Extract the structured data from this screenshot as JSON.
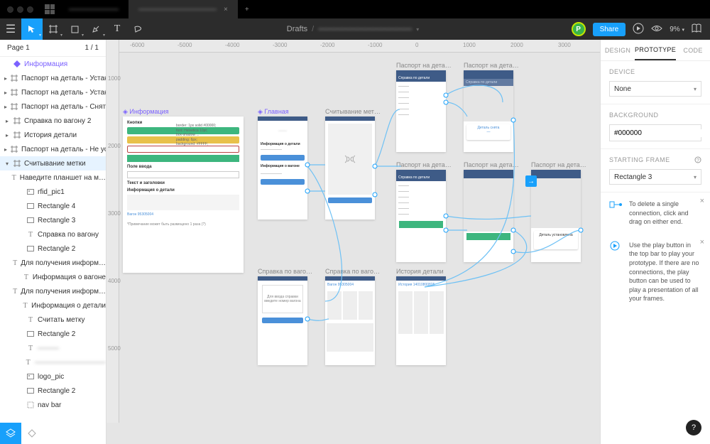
{
  "tabs": {
    "tab1": "———————",
    "tab2": "———————————"
  },
  "toolbar": {
    "drafts": "Drafts",
    "filename": "————————————",
    "avatar_initial": "P",
    "share": "Share",
    "zoom": "9%"
  },
  "pages": {
    "title": "Page 1",
    "index": "1 / 1"
  },
  "layers": [
    {
      "icon": "component",
      "label": "Информация",
      "component": true
    },
    {
      "icon": "frame",
      "label": "Паспорт на деталь - Устано…",
      "exp": true
    },
    {
      "icon": "frame",
      "label": "Паспорт на деталь - Устано…",
      "exp": true
    },
    {
      "icon": "frame",
      "label": "Паспорт на деталь - Снятие",
      "exp": true
    },
    {
      "icon": "frame",
      "label": "Справка по вагону 2",
      "exp": true
    },
    {
      "icon": "frame",
      "label": "История детали",
      "exp": true
    },
    {
      "icon": "frame",
      "label": "Паспорт на деталь - Не уст…",
      "exp": true
    },
    {
      "icon": "frame",
      "label": "Считывание метки",
      "exp": true,
      "expanded": true,
      "sel": true
    },
    {
      "indent": 1,
      "icon": "text",
      "label": "Наведите планшет на м…"
    },
    {
      "indent": 1,
      "icon": "image",
      "label": "rfid_pic1"
    },
    {
      "indent": 1,
      "icon": "rect",
      "label": "Rectangle 4"
    },
    {
      "indent": 1,
      "icon": "rect",
      "label": "Rectangle 3"
    },
    {
      "indent": 1,
      "icon": "text",
      "label": "Справка по вагону"
    },
    {
      "indent": 1,
      "icon": "rect",
      "label": "Rectangle 2"
    },
    {
      "indent": 1,
      "icon": "text",
      "label": "Для получения информ…"
    },
    {
      "indent": 1,
      "icon": "text",
      "label": "Информация о вагоне"
    },
    {
      "indent": 1,
      "icon": "text",
      "label": "Для получения информ…"
    },
    {
      "indent": 1,
      "icon": "text",
      "label": "Информация о детали"
    },
    {
      "indent": 1,
      "icon": "text",
      "label": "Считать метку"
    },
    {
      "indent": 1,
      "icon": "rect",
      "label": "Rectangle 2"
    },
    {
      "indent": 1,
      "icon": "text",
      "label": "———",
      "blur": true
    },
    {
      "indent": 1,
      "icon": "text",
      "label": "——————————",
      "blur": true
    },
    {
      "indent": 1,
      "icon": "image",
      "label": "logo_pic"
    },
    {
      "indent": 1,
      "icon": "rect",
      "label": "Rectangle 2"
    },
    {
      "indent": 1,
      "icon": "group",
      "label": "nav bar"
    }
  ],
  "ruler_h": [
    "-6000",
    "-5000",
    "-4000",
    "-3000",
    "-2000",
    "-1000",
    "0",
    "1000",
    "2000",
    "3000"
  ],
  "ruler_v": [
    "1000",
    "2000",
    "3000",
    "4000",
    "5000"
  ],
  "frames": {
    "info": {
      "label": "Информация",
      "h1": "Кнопки",
      "h2": "Информация о детали",
      "h3": "Поле ввода",
      "h4": "Текст и заголовки",
      "wagon": "Вагон 95305004",
      "footnote": "*Примечание может быть размещено 1 раза (?)"
    },
    "main": {
      "label": "Главная",
      "t1": "Информация о детали",
      "t2": "Информация о вагоне"
    },
    "scan": {
      "label": "Считывание мет…"
    },
    "pass1": {
      "label": "Паспорт на дета…",
      "sub": "Справка по детали"
    },
    "pass2": {
      "label": "Паспорт на дета…",
      "sub": "Справка по детали"
    },
    "pass3": {
      "label": "Паспорт на дета…",
      "sub": "Справка по детали"
    },
    "pass4": {
      "label": "Паспорт на дета…"
    },
    "pass5": {
      "label": "Паспорт на дета…",
      "sub": "Деталь установлена"
    },
    "ref1": {
      "label": "Справка по ваго…"
    },
    "ref2": {
      "label": "Справка по ваго…",
      "wagon": "Вагон 95305004"
    },
    "hist": {
      "label": "История детали",
      "sub": "История 14010800825"
    }
  },
  "right": {
    "tab_design": "DESIGN",
    "tab_proto": "PROTOTYPE",
    "tab_code": "CODE",
    "device": "DEVICE",
    "device_value": "None",
    "background": "BACKGROUND",
    "bg_value": "#000000",
    "starting": "STARTING FRAME",
    "starting_value": "Rectangle 3",
    "hint1": "To delete a single connection, click and drag on either end.",
    "hint2": "Use the play button in the top bar to play your prototype. If there are no connections, the play button can be used to play a presentation of all your frames."
  }
}
